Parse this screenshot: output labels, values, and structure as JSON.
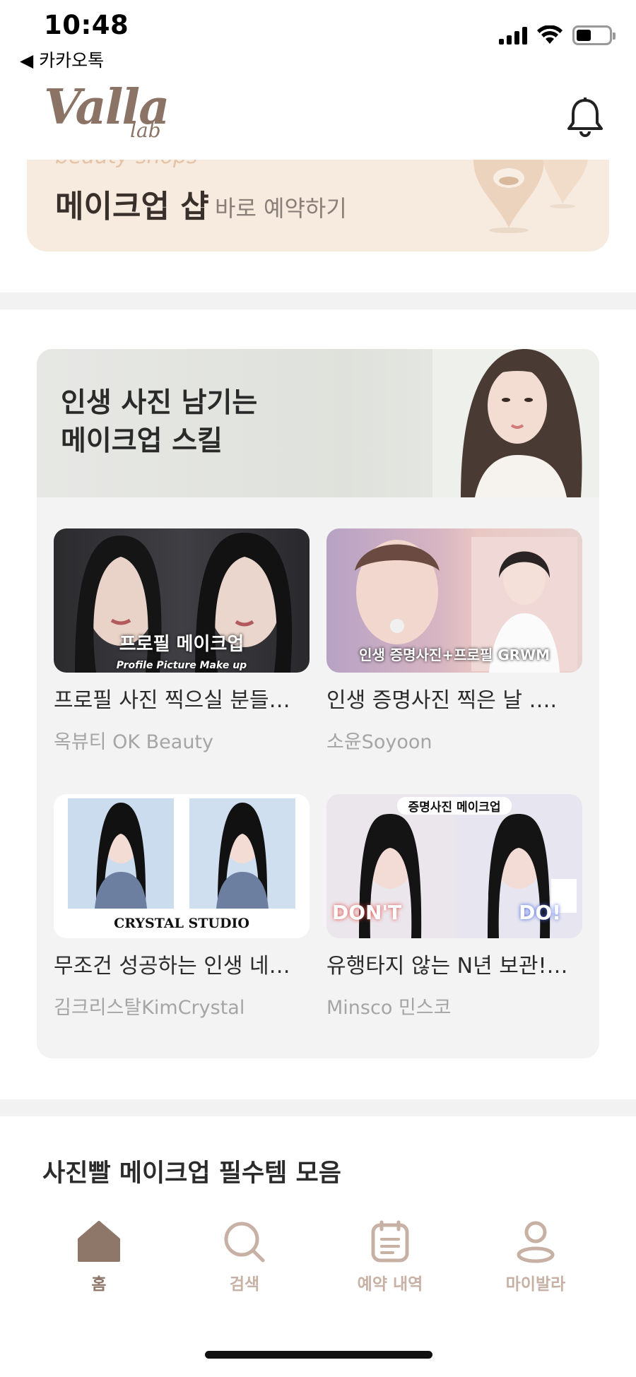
{
  "status": {
    "time": "10:48",
    "back_app": "◀ 카카오톡"
  },
  "header": {
    "logo_main": "Valla",
    "logo_sub": "lab"
  },
  "promo": {
    "faded_text": "beauty shops",
    "title": "메이크업 샵",
    "subtitle": "바로 예약하기"
  },
  "card": {
    "headline": "인생 사진 남기는\n메이크업 스킬",
    "videos": [
      {
        "title": "프로필 사진 찍으실 분들…",
        "channel": "옥뷰티 OK Beauty",
        "thumb_caption": "프로필 메이크업",
        "thumb_caption_sub": "Profile Picture Make up"
      },
      {
        "title": "인생 증명사진 찍은 날 ….",
        "channel": "소윤Soyoon",
        "thumb_caption": "인생 증명사진+프로필 GRWM"
      },
      {
        "title": "무조건 성공하는 인생 네…",
        "channel": "김크리스탈KimCrystal",
        "thumb_caption": "CRYSTAL STUDIO"
      },
      {
        "title": "유행타지 않는 N년 보관!…",
        "channel": "Minsco 민스코",
        "thumb_caption": "증명사진 메이크업",
        "dont_label": "DON'T",
        "do_label": "DO!"
      }
    ]
  },
  "section": {
    "title": "사진빨 메이크업 필수템 모음"
  },
  "tabbar": {
    "tabs": [
      {
        "label": "홈",
        "active": true
      },
      {
        "label": "검색",
        "active": false
      },
      {
        "label": "예약 내역",
        "active": false
      },
      {
        "label": "마이발라",
        "active": false
      }
    ]
  },
  "colors": {
    "brand": "#8b7466",
    "tab_inactive": "#c7b1a4",
    "promo_bg": "#f7eadf",
    "card_bg": "#f3f3f4"
  }
}
